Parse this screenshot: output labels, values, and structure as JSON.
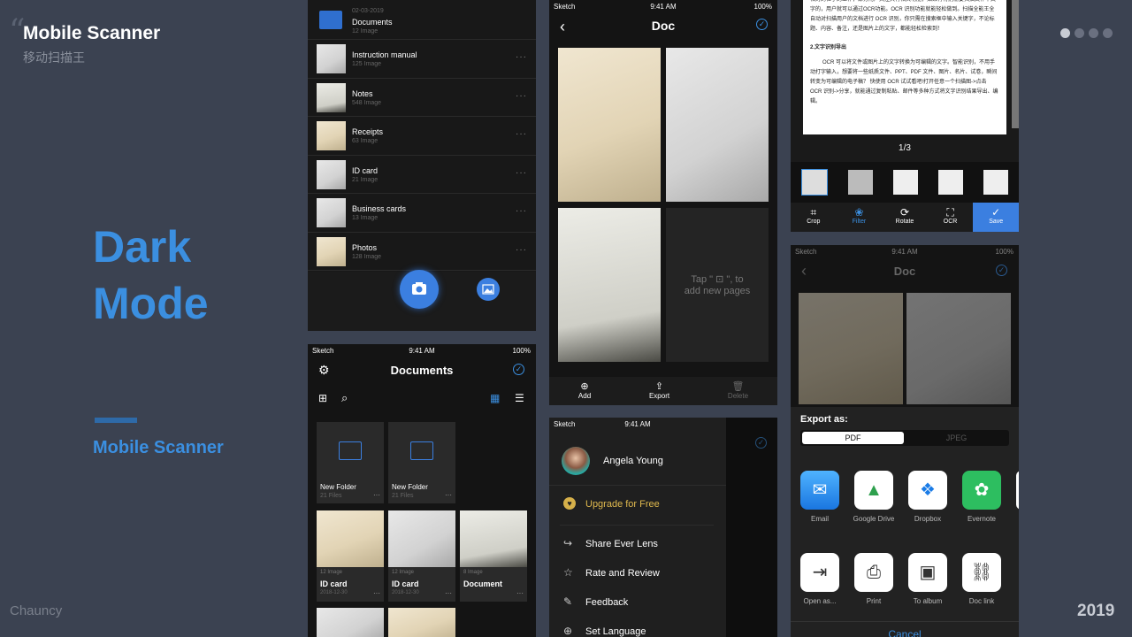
{
  "brand": {
    "title": "Mobile Scanner",
    "subtitle": "移动扫描王",
    "hero_line1": "Dark",
    "hero_line2": "Mode",
    "tagline": "Mobile Scanner",
    "author": "Chauncy",
    "year": "2019",
    "accent": "#3b8fe0"
  },
  "status": {
    "carrier": "Sketch",
    "time": "9:41 AM",
    "battery": "100%"
  },
  "list_screen": {
    "items": [
      {
        "date": "02-03-2019",
        "title": "Documents",
        "count": "12 Image"
      },
      {
        "title": "Instruction manual",
        "count": "125 Image"
      },
      {
        "title": "Notes",
        "count": "548 Image"
      },
      {
        "title": "Receipts",
        "count": "63 Image"
      },
      {
        "title": "ID card",
        "count": "21 Image"
      },
      {
        "title": "Business cards",
        "count": "13 Image"
      },
      {
        "title": "Photos",
        "count": "128 Image"
      }
    ],
    "more": "···"
  },
  "doc_screen": {
    "title": "Doc",
    "hint_line1": "Tap \" ",
    "hint_line2": " \", to",
    "hint_line3": "add new pages",
    "actions": [
      "Add",
      "Export",
      "Delete"
    ]
  },
  "edit_screen": {
    "text_top": "相对的位于的工作，部分用户关注具有相关功能，如果有特别需要扫描文件中文字的，用户就可以通过OCR功能。OCR 识别功能就能轻松做到。扫描全能王全自动对扫描用户的文档进行 OCR 识别，你只需在搜索框中输入关键字，不论标题、内容、备注，还是图片上的文字，都能轻松检索到！",
    "heading": "2.文字识别导出",
    "text_body": "OCR 可以将文件或图片上的文字转换为可编辑的文字。智能识别，不用手动打字输入，想要将一些纸质文件、PPT、PDF 文件、图片、名片、试卷，瞬间转变为可编辑的电子稿？ 快使用 OCR 试试看吧!打开任意一个扫描图->点击 OCR 识别->分享，就能通过复制粘贴、邮件等多种方式将文字识别结果导出、编辑。",
    "pager": "1/3",
    "tools": [
      "Crop",
      "Filter",
      "Rotate",
      "OCR",
      "Save"
    ]
  },
  "documents_screen": {
    "title": "Documents",
    "folders": [
      {
        "name": "New Folder",
        "files": "21 Files"
      },
      {
        "name": "New Folder",
        "files": "21 Files"
      }
    ],
    "docs": [
      {
        "count": "12 Image",
        "name": "ID card",
        "date": "2018-12-30"
      },
      {
        "count": "12 Image",
        "name": "ID card",
        "date": "2018-12-30"
      },
      {
        "count": "8 Image",
        "name": "Document",
        "date": ""
      }
    ]
  },
  "menu_screen": {
    "user": "Angela Young",
    "upgrade": "Upgrade for Free",
    "items": [
      "Share Ever Lens",
      "Rate and Review",
      "Feedback",
      "Set Language"
    ]
  },
  "export_screen": {
    "title": "Doc",
    "export_label": "Export as:",
    "formats": [
      "PDF",
      "JPEG"
    ],
    "apps_row1": [
      "Email",
      "Google Drive",
      "Dropbox",
      "Evernote"
    ],
    "apps_row2": [
      "Open as...",
      "Print",
      "To album",
      "Doc link"
    ],
    "cancel": "Cancel"
  },
  "pager_dots": 4
}
